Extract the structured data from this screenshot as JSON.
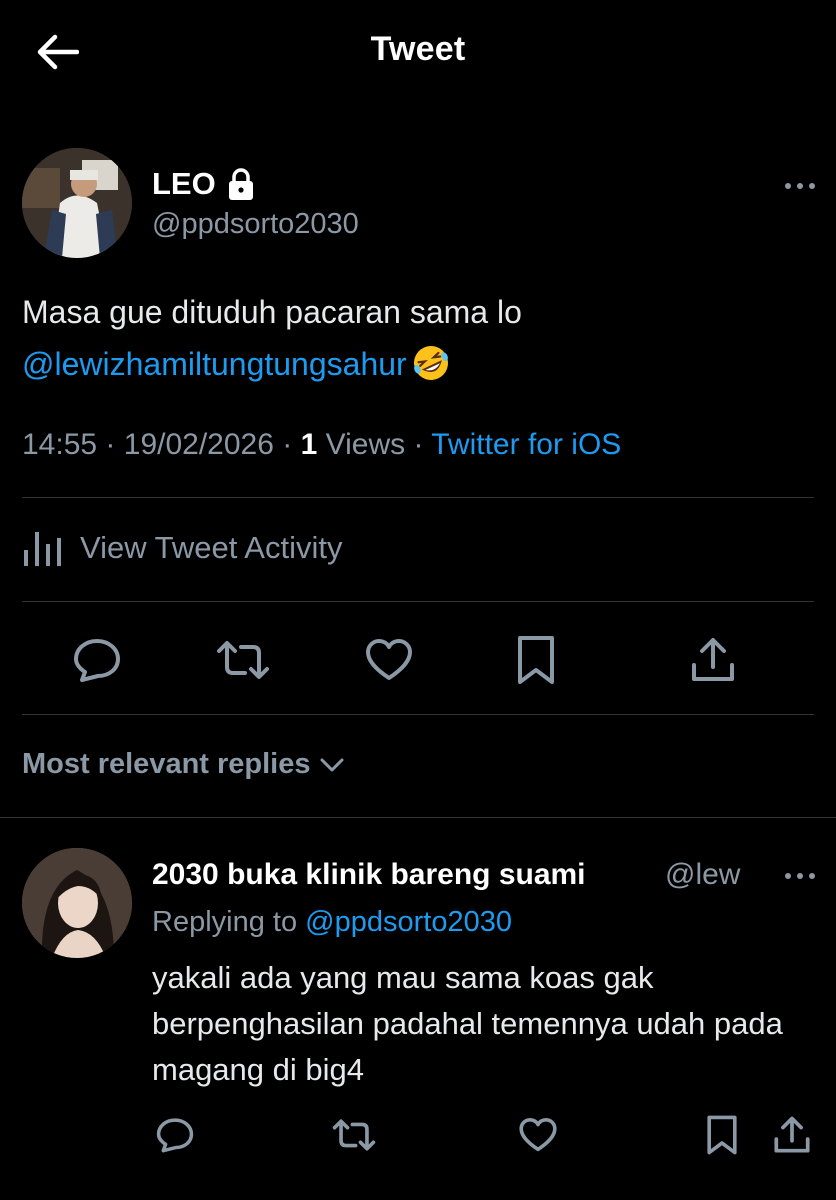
{
  "header": {
    "title": "Tweet",
    "back_icon": "arrow-left-icon"
  },
  "tweet": {
    "author_name": "LEO",
    "author_handle": "@ppdsorto2030",
    "protected_icon": "lock-icon",
    "text_line1": "Masa gue dituduh pacaran sama lo",
    "mention": "@lewizhamiltungtungsahur",
    "emoji": "rolling-on-floor-laughing-emoji",
    "time": "14:55",
    "date": "19/02/2026",
    "views_count": "1",
    "views_label": "Views",
    "source": "Twitter for iOS",
    "separator": "·"
  },
  "activity": {
    "label": "View Tweet Activity",
    "icon": "bar-chart-icon"
  },
  "actions": [
    "reply-icon",
    "retweet-icon",
    "like-icon",
    "bookmark-icon",
    "share-icon"
  ],
  "replies_sort": {
    "label": "Most relevant replies",
    "icon": "chevron-down-icon"
  },
  "reply": {
    "author_name": "2030 buka klinik bareng suami",
    "author_handle": "@lew",
    "replying_prefix": "Replying to",
    "replying_to": "@ppdsorto2030",
    "text": "yakali ada yang mau sama koas gak berpenghasilan padahal temennya udah pada magang di big4"
  },
  "colors": {
    "background": "#000000",
    "link": "#1d9bf0",
    "muted": "#8b98a5",
    "divider": "#2f3336"
  }
}
